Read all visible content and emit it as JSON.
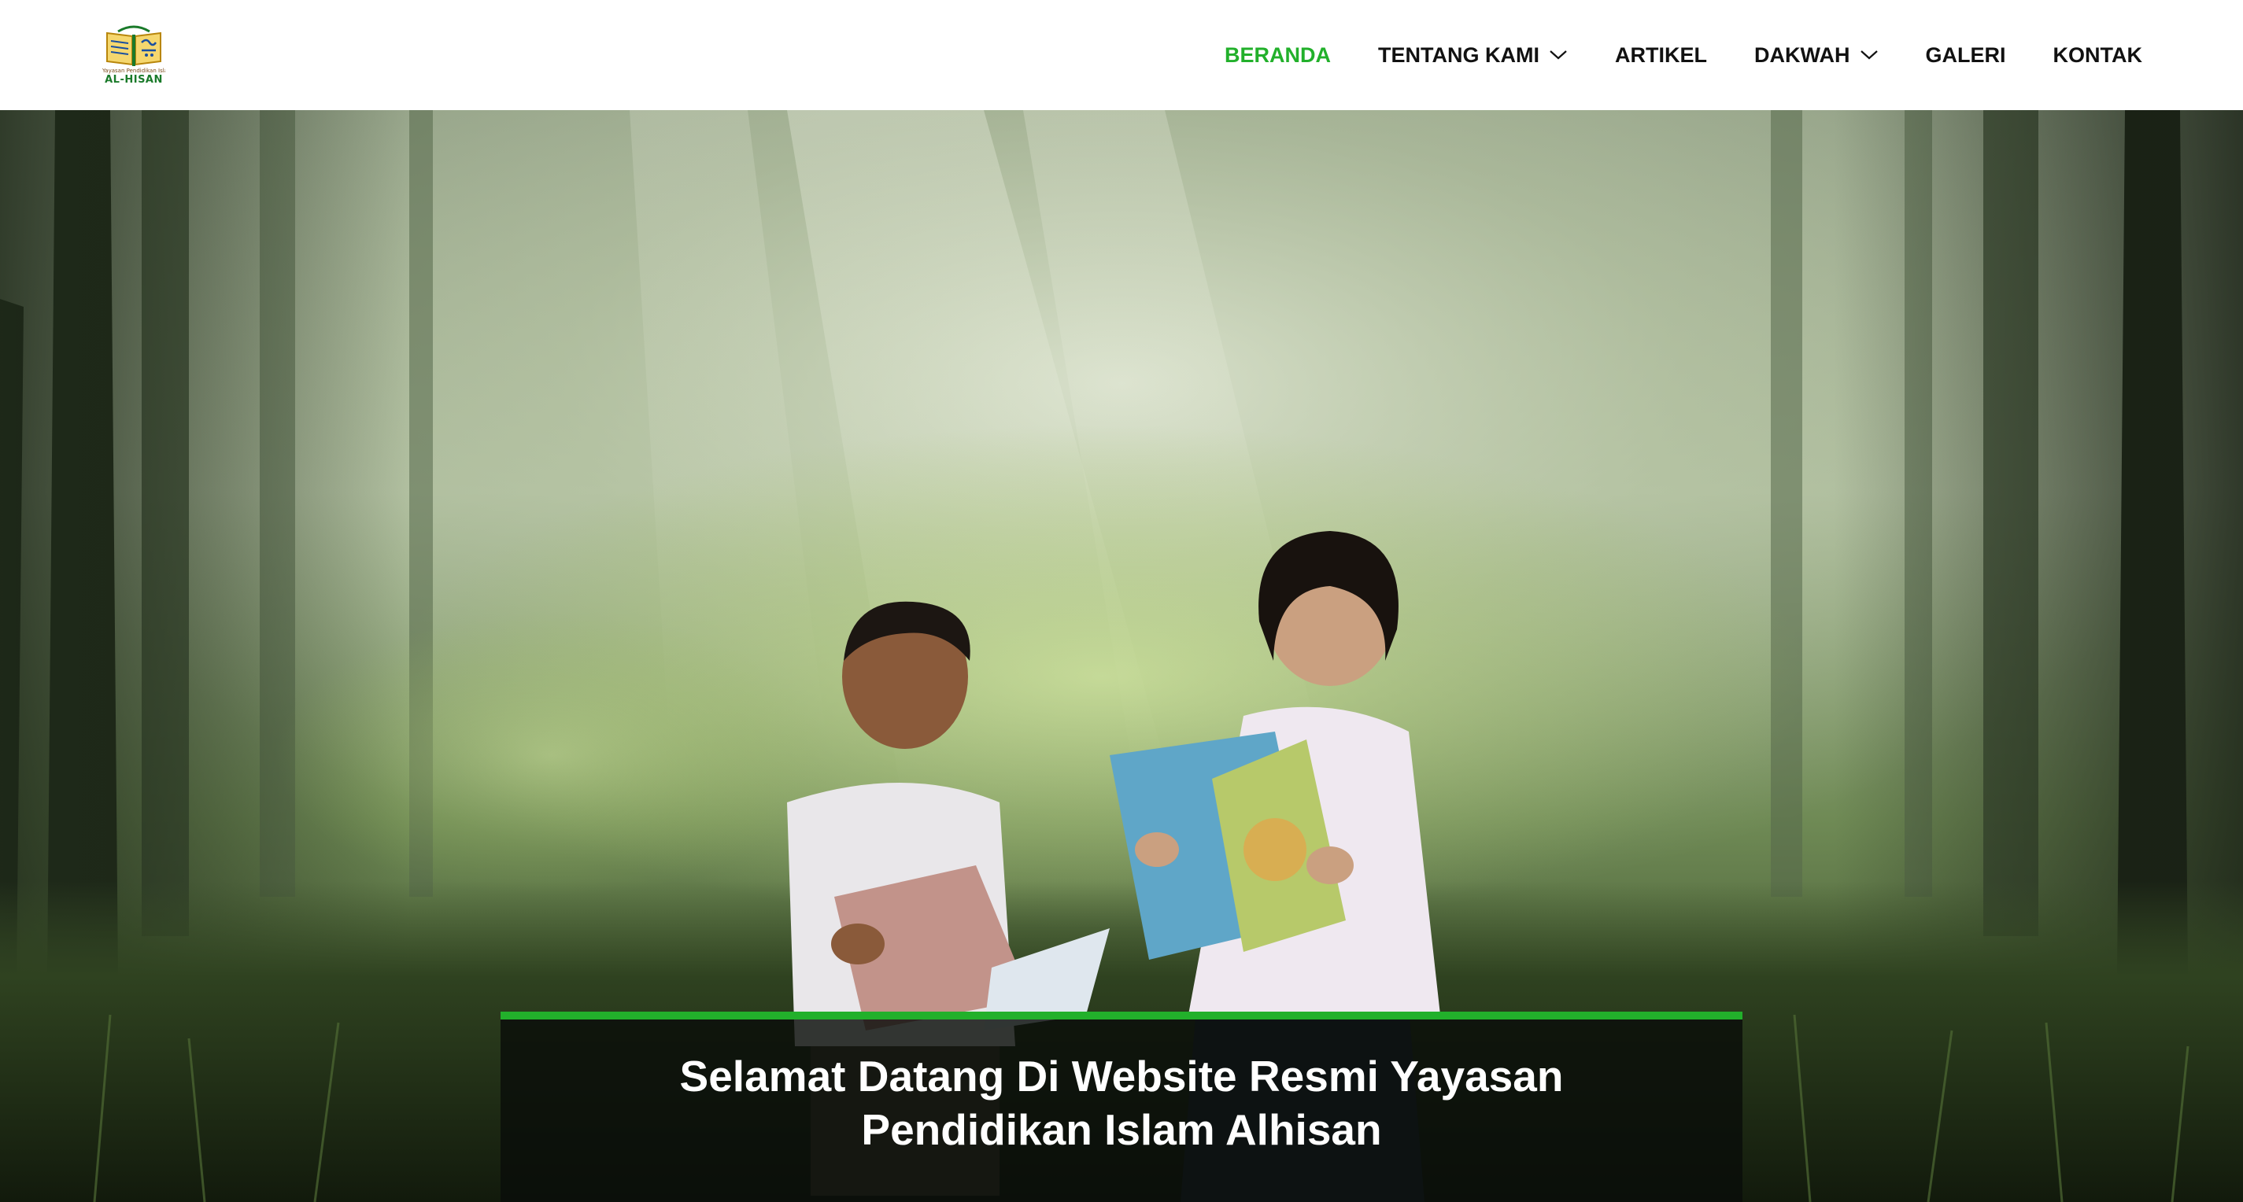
{
  "logo": {
    "subtitle": "Yayasan Pendidikan Islam",
    "name": "AL-HISAN"
  },
  "nav": {
    "items": [
      {
        "label": "BERANDA",
        "active": true,
        "dropdown": false
      },
      {
        "label": "TENTANG KAMI",
        "active": false,
        "dropdown": true
      },
      {
        "label": "ARTIKEL",
        "active": false,
        "dropdown": false
      },
      {
        "label": "DAKWAH",
        "active": false,
        "dropdown": true
      },
      {
        "label": "GALERI",
        "active": false,
        "dropdown": false
      },
      {
        "label": "KONTAK",
        "active": false,
        "dropdown": false
      }
    ]
  },
  "hero": {
    "image_icon": "forest-children-reading-photo",
    "title": "Selamat Datang Di Website Resmi Yayasan Pendidikan Islam Alhisan"
  },
  "colors": {
    "accent": "#22b02b",
    "nav_text": "#111111",
    "caption_bg": "#0a0e0a",
    "header_bg": "#ffffff"
  }
}
